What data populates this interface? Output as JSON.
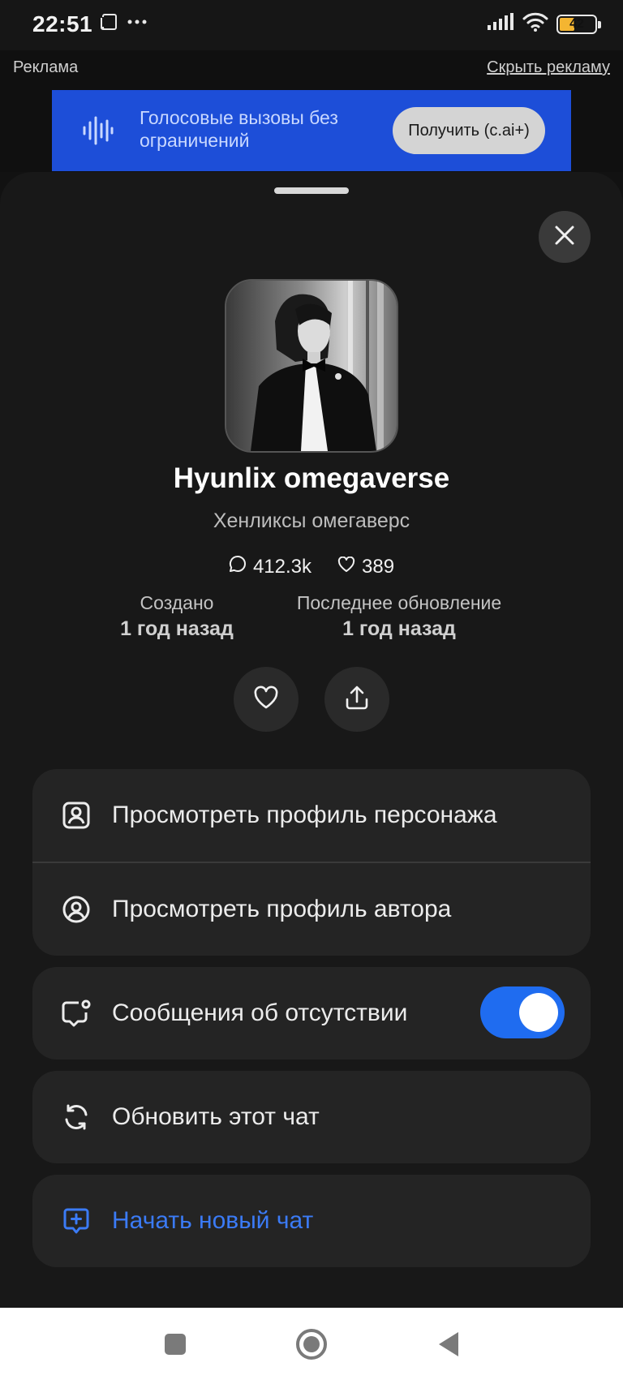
{
  "status_bar": {
    "time": "22:51",
    "battery": "42",
    "battery_level": 0.42
  },
  "ad": {
    "label": "Реклама",
    "hide_label": "Скрыть рекламу",
    "banner_text": "Голосовые вызовы без ограничений",
    "cta_label": "Получить (c.ai+)",
    "banner_color": "#1d4ed8"
  },
  "character": {
    "name": "Hyunlix omegaverse",
    "tagline": "Хенликсы омегаверс",
    "chats_count": "412.3k",
    "likes_count": "389",
    "created_label": "Создано",
    "created_value": "1 год назад",
    "updated_label": "Последнее обновление",
    "updated_value": "1 год назад"
  },
  "menu": {
    "view_character_profile": "Просмотреть профиль персонажа",
    "view_author_profile": "Просмотреть профиль автора",
    "away_messages": "Сообщения об отсутствии",
    "away_messages_enabled": true,
    "refresh_chat": "Обновить этот чат",
    "new_chat": "Начать новый чат"
  },
  "colors": {
    "accent": "#1f6cf0",
    "new_chat_text": "#3b7bf6",
    "sheet_bg": "#181818",
    "card_bg": "#242424"
  },
  "icons": {
    "status": [
      "screen-icon",
      "more-dots-icon",
      "signal-icon",
      "wifi-icon",
      "battery-icon"
    ],
    "close": "close-icon",
    "chat": "chat-bubble-icon",
    "heart": "heart-icon",
    "share": "share-icon",
    "profile_card": "profile-card-icon",
    "user_circle": "user-circle-icon",
    "away": "away-message-icon",
    "refresh": "refresh-icon",
    "new_chat": "new-chat-icon",
    "nav": [
      "recents-icon",
      "home-icon",
      "back-icon"
    ]
  }
}
